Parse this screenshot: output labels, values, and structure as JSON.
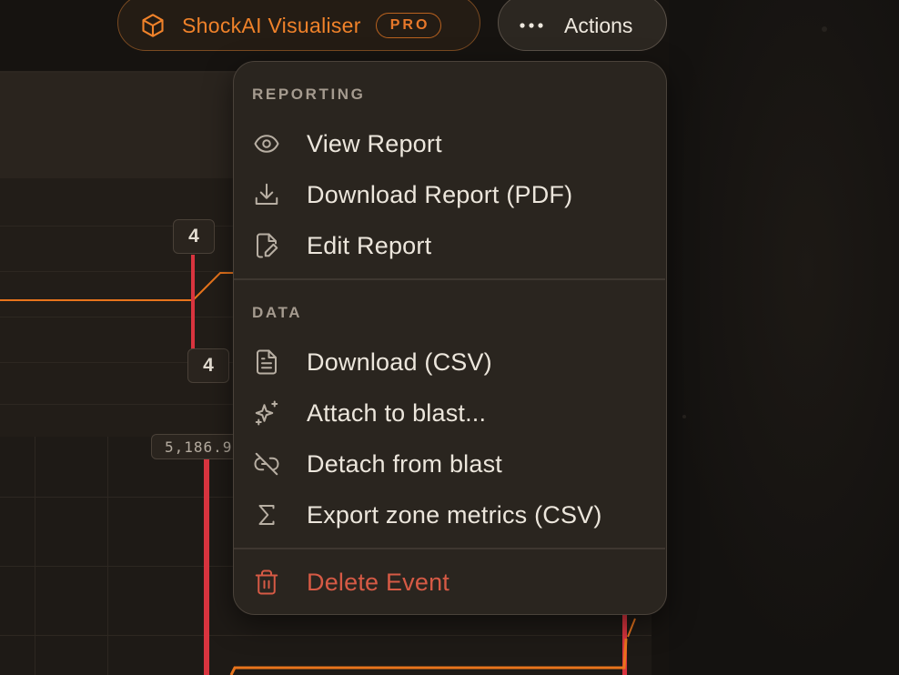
{
  "header": {
    "brand_title": "ShockAI Visualiser",
    "brand_badge": "PRO",
    "brand_icon": "cube-icon",
    "actions_label": "Actions",
    "actions_icon": "more-horizontal-icon"
  },
  "background": {
    "marker_tag_top": "4",
    "marker_tag_mid": "4",
    "value_chip": "5,186.9"
  },
  "menu": {
    "sections": [
      {
        "label": "REPORTING",
        "items": [
          {
            "label": "View Report",
            "icon": "eye-icon"
          },
          {
            "label": "Download Report (PDF)",
            "icon": "download-icon"
          },
          {
            "label": "Edit Report",
            "icon": "file-edit-icon"
          }
        ]
      },
      {
        "label": "DATA",
        "items": [
          {
            "label": "Download (CSV)",
            "icon": "file-text-icon"
          },
          {
            "label": "Attach to blast...",
            "icon": "sparkles-icon"
          },
          {
            "label": "Detach from blast",
            "icon": "unlink-icon"
          },
          {
            "label": "Export zone metrics (CSV)",
            "icon": "sigma-icon"
          }
        ]
      }
    ],
    "danger_item": {
      "label": "Delete Event",
      "icon": "trash-icon"
    }
  },
  "colors": {
    "accent": "#f0822a",
    "danger": "#d65a45",
    "marker": "#d9343f",
    "series": "#e8741c"
  }
}
